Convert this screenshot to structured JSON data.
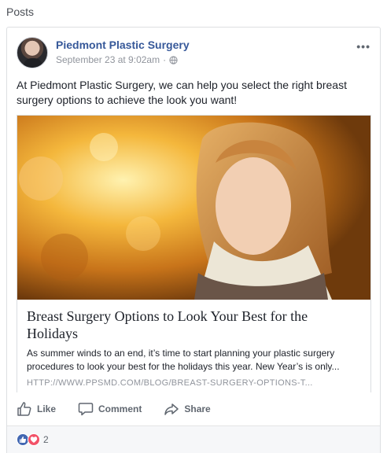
{
  "section": {
    "title": "Posts"
  },
  "post": {
    "author": "Piedmont Plastic Surgery",
    "timestamp": "September 23 at 9:02am",
    "separator": "·",
    "more_icon": "more-horizontal-icon",
    "text": "At Piedmont Plastic Surgery, we can help you select the right breast surgery options to achieve the look you want!",
    "link": {
      "title": "Breast Surgery Options to Look Your Best for the Holidays",
      "description": "As summer winds to an end, it’s time to start planning your plastic surgery procedures to look your best for the holidays this year. New Year’s is only...",
      "domain": "HTTP://WWW.PPSMD.COM/BLOG/BREAST-SURGERY-OPTIONS-T..."
    },
    "actions": {
      "like": "Like",
      "comment": "Comment",
      "share": "Share"
    },
    "reactions": {
      "count": "2"
    }
  },
  "colors": {
    "link_blue": "#365899",
    "like_blue": "#4267b2",
    "love_red": "#f25268"
  }
}
